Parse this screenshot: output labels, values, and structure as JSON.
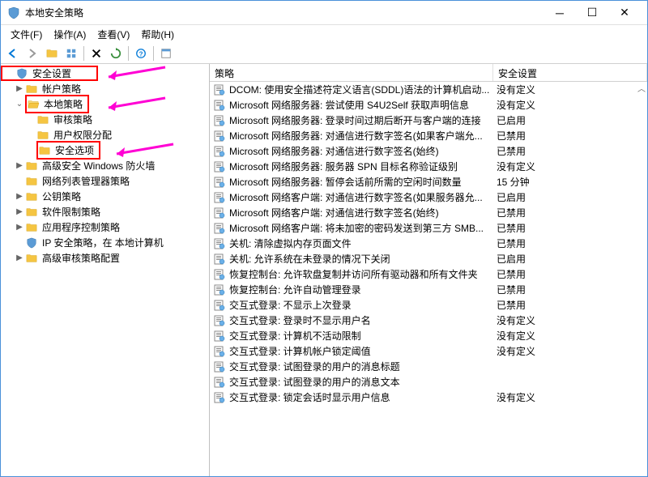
{
  "window": {
    "title": "本地安全策略"
  },
  "menu": {
    "file": "文件(F)",
    "action": "操作(A)",
    "view": "查看(V)",
    "help": "帮助(H)"
  },
  "tree": {
    "root": "安全设置",
    "account": "帐户策略",
    "local": "本地策略",
    "audit": "审核策略",
    "user_rights": "用户权限分配",
    "security_options": "安全选项",
    "firewall": "高级安全 Windows 防火墙",
    "network_list": "网络列表管理器策略",
    "public_key": "公钥策略",
    "software_restrict": "软件限制策略",
    "app_control": "应用程序控制策略",
    "ipsec": "IP 安全策略，在 本地计算机",
    "adv_audit": "高级审核策略配置"
  },
  "columns": {
    "policy": "策略",
    "setting": "安全设置"
  },
  "rows": [
    {
      "p": "DCOM: 使用安全描述符定义语言(SDDL)语法的计算机启动...",
      "s": "没有定义"
    },
    {
      "p": "Microsoft 网络服务器: 尝试使用 S4U2Self 获取声明信息",
      "s": "没有定义"
    },
    {
      "p": "Microsoft 网络服务器: 登录时间过期后断开与客户端的连接",
      "s": "已启用"
    },
    {
      "p": "Microsoft 网络服务器: 对通信进行数字签名(如果客户端允...",
      "s": "已禁用"
    },
    {
      "p": "Microsoft 网络服务器: 对通信进行数字签名(始终)",
      "s": "已禁用"
    },
    {
      "p": "Microsoft 网络服务器: 服务器 SPN 目标名称验证级别",
      "s": "没有定义"
    },
    {
      "p": "Microsoft 网络服务器: 暂停会话前所需的空闲时间数量",
      "s": "15 分钟"
    },
    {
      "p": "Microsoft 网络客户端: 对通信进行数字签名(如果服务器允...",
      "s": "已启用"
    },
    {
      "p": "Microsoft 网络客户端: 对通信进行数字签名(始终)",
      "s": "已禁用"
    },
    {
      "p": "Microsoft 网络客户端: 将未加密的密码发送到第三方 SMB...",
      "s": "已禁用"
    },
    {
      "p": "关机: 清除虚拟内存页面文件",
      "s": "已禁用"
    },
    {
      "p": "关机: 允许系统在未登录的情况下关闭",
      "s": "已启用"
    },
    {
      "p": "恢复控制台: 允许软盘复制并访问所有驱动器和所有文件夹",
      "s": "已禁用"
    },
    {
      "p": "恢复控制台: 允许自动管理登录",
      "s": "已禁用"
    },
    {
      "p": "交互式登录: 不显示上次登录",
      "s": "已禁用"
    },
    {
      "p": "交互式登录: 登录时不显示用户名",
      "s": "没有定义"
    },
    {
      "p": "交互式登录: 计算机不活动限制",
      "s": "没有定义"
    },
    {
      "p": "交互式登录: 计算机帐户锁定阈值",
      "s": "没有定义"
    },
    {
      "p": "交互式登录: 试图登录的用户的消息标题",
      "s": ""
    },
    {
      "p": "交互式登录: 试图登录的用户的消息文本",
      "s": ""
    },
    {
      "p": "交互式登录: 锁定会话时显示用户信息",
      "s": "没有定义"
    }
  ]
}
